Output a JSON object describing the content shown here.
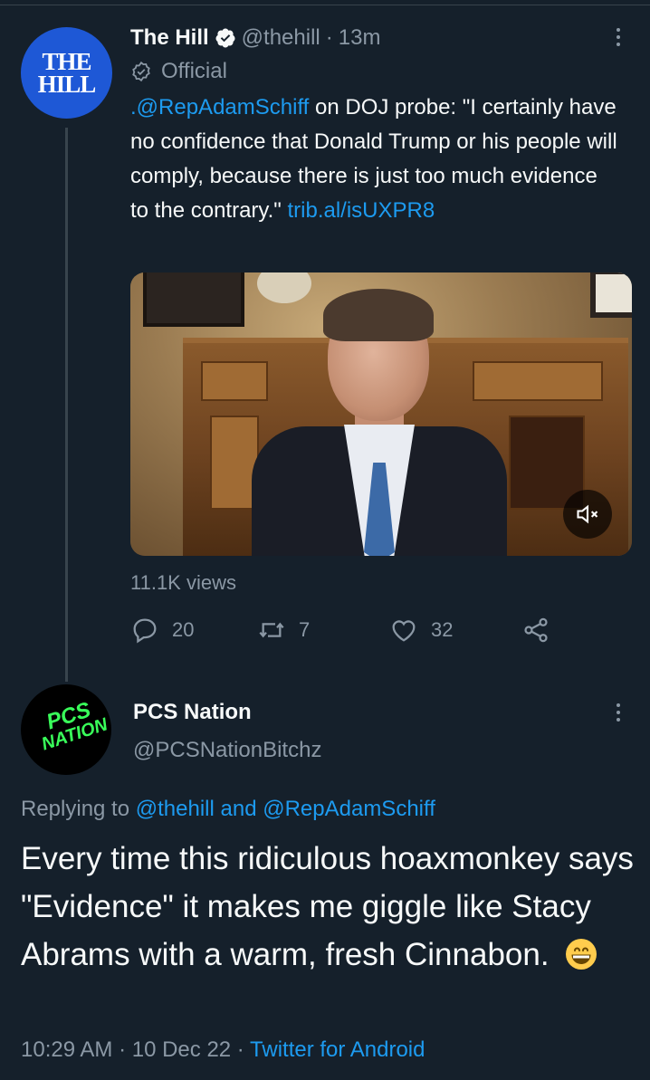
{
  "tweet1": {
    "avatar_text": [
      "THE",
      "HILL"
    ],
    "name": "The Hill",
    "handle": "@thehill",
    "separator": "·",
    "time": "13m",
    "label": "Official",
    "text_mention": ".@RepAdamSchiff",
    "text_body": " on DOJ probe: \"I certainly have no confidence that Donald Trump or his people will comply, because there is just too much evidence to the contrary.\" ",
    "text_link": "trib.al/isUXPR8",
    "media_mute_icon": "volume-mute-icon",
    "views": "11.1K views",
    "replies": "20",
    "retweets": "7",
    "likes": "32"
  },
  "tweet2": {
    "avatar_text": [
      "PCS",
      "NATION"
    ],
    "name": "PCS Nation",
    "handle": "@PCSNationBitchz",
    "replying_prefix": "Replying to ",
    "replying_user1": "@thehill",
    "replying_and": " and ",
    "replying_user2": "@RepAdamSchiff",
    "text": "Every time this ridiculous hoaxmonkey says \"Evidence\" it makes me giggle like Stacy Abrams with a warm, fresh Cinnabon.",
    "emoji": "grinning-face-emoji",
    "time": "10:29 AM",
    "date": "10 Dec 22",
    "sep1": " · ",
    "sep2": " · ",
    "source": "Twitter for Android"
  },
  "colors": {
    "background": "#15202b",
    "text": "#f7f9f9",
    "secondary": "#8b98a5",
    "link": "#1d9bf0",
    "hill_blue": "#1e58d6",
    "pcs_green": "#39ff5a"
  }
}
